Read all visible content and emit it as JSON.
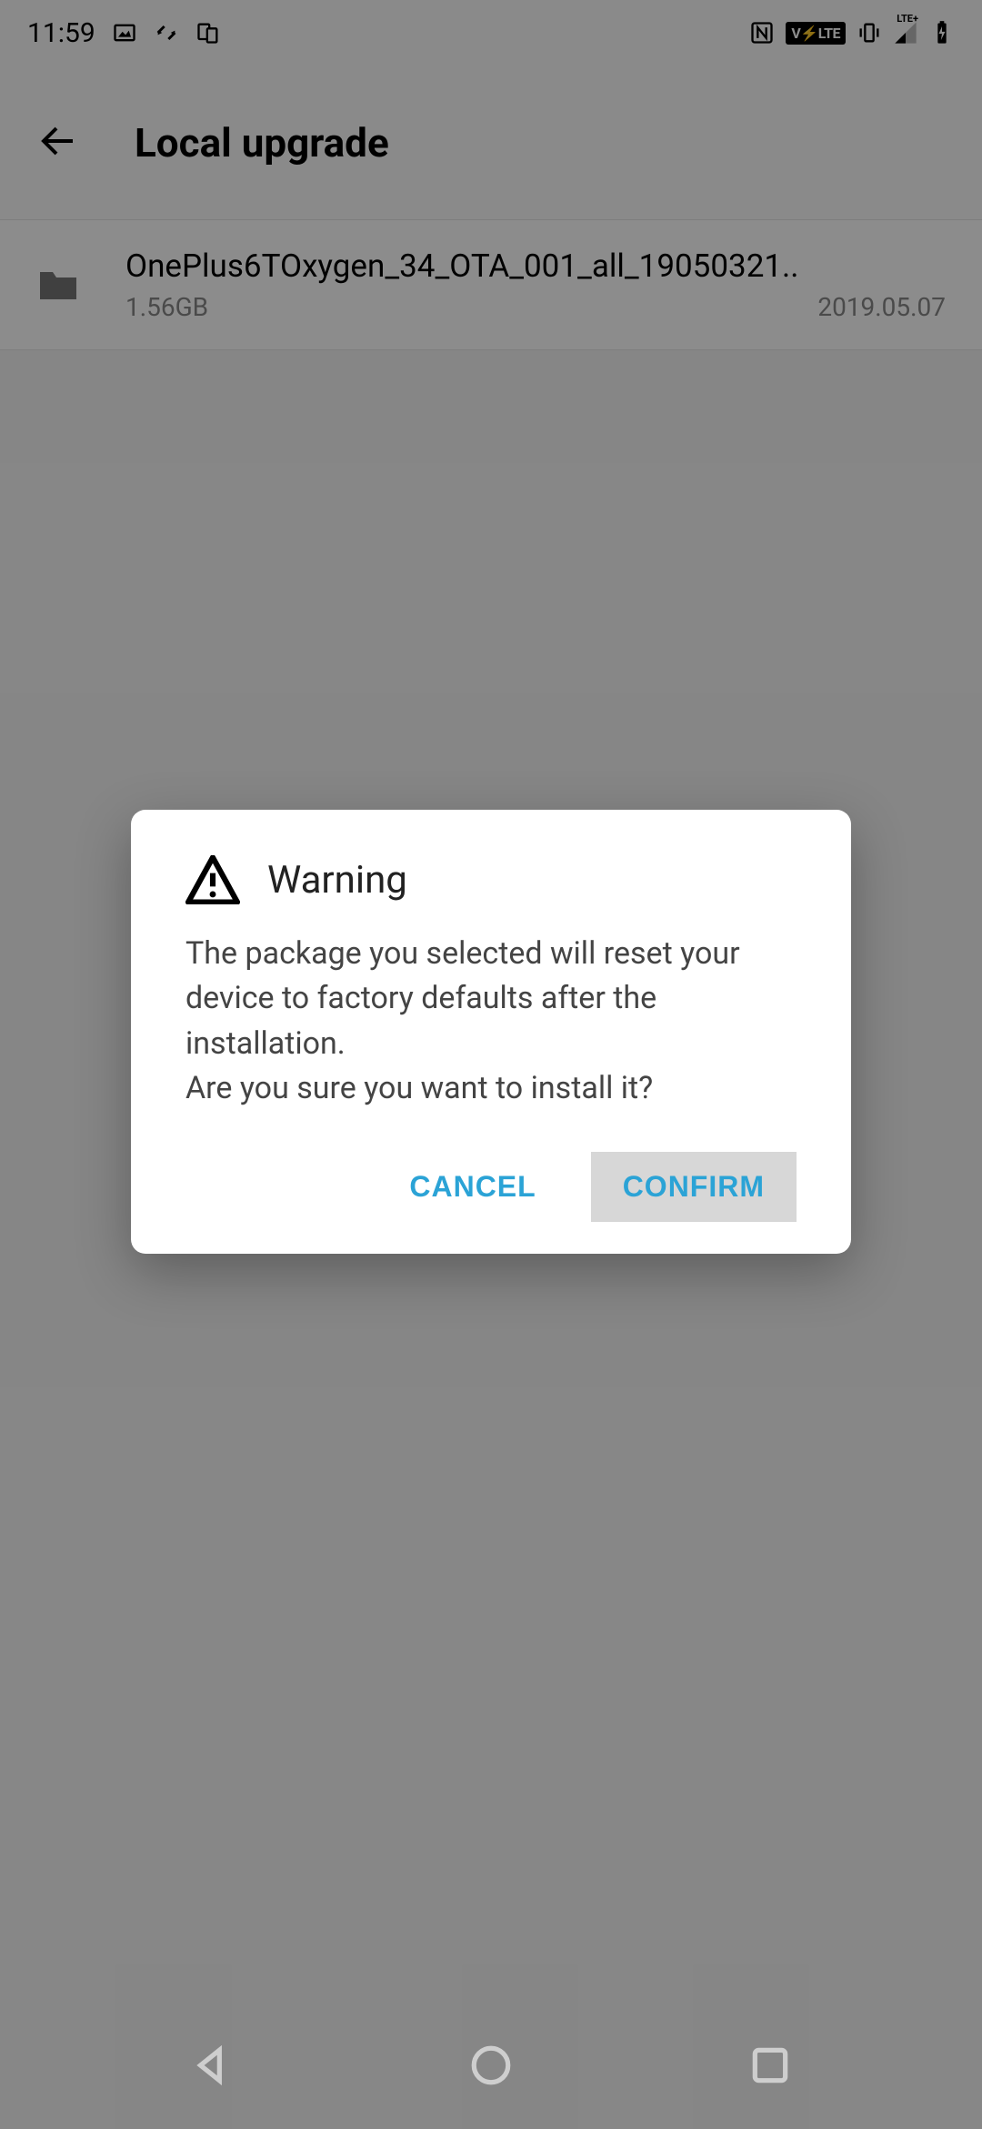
{
  "status": {
    "time": "11:59",
    "volte": "V⚡LTE",
    "lte": "LTE+"
  },
  "header": {
    "title": "Local upgrade"
  },
  "files": [
    {
      "name": "OnePlus6TOxygen_34_OTA_001_all_19050321..",
      "size": "1.56GB",
      "date": "2019.05.07"
    }
  ],
  "dialog": {
    "title": "Warning",
    "message": "The package you selected will reset your device to factory defaults after the installation.\nAre you sure you want to install it?",
    "cancel": "CANCEL",
    "confirm": "CONFIRM"
  }
}
